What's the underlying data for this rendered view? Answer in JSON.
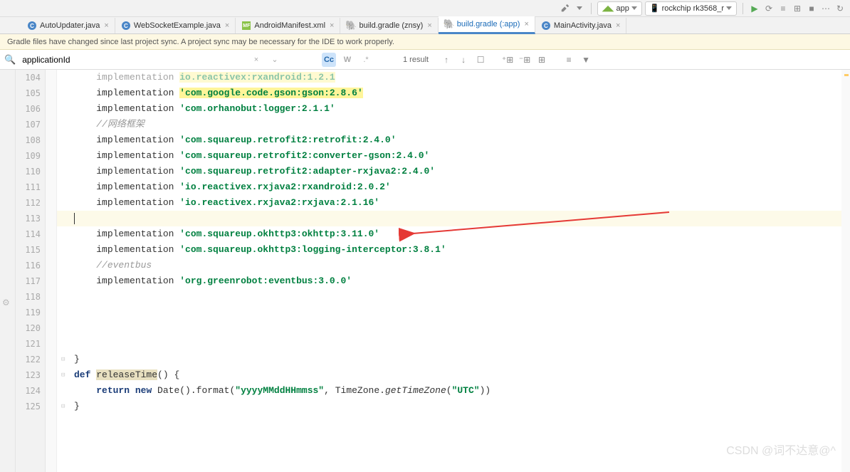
{
  "toolbar": {
    "run_config": "app",
    "device": "rockchip rk3568_r"
  },
  "tabs": [
    {
      "label": "AutoUpdater.java",
      "icon": "java",
      "active": false
    },
    {
      "label": "WebSocketExample.java",
      "icon": "java",
      "active": false
    },
    {
      "label": "AndroidManifest.xml",
      "icon": "manifest",
      "active": false
    },
    {
      "label": "build.gradle (znsy)",
      "icon": "gradle",
      "active": false
    },
    {
      "label": "build.gradle (:app)",
      "icon": "gradle",
      "active": true
    },
    {
      "label": "MainActivity.java",
      "icon": "java",
      "active": false
    }
  ],
  "notify": "Gradle files have changed since last project sync. A project sync may be necessary for the IDE to work properly.",
  "find": {
    "query": "applicationId",
    "result_count": "1 result"
  },
  "lines": {
    "start": 104,
    "end": 125
  },
  "code": {
    "l104": {
      "impl": "implementation",
      "dep": "io.reactivex:rxandroid:1.2.1"
    },
    "l105": {
      "impl": "implementation",
      "dep": "'com.google.code.gson:gson:2.8.6'"
    },
    "l106": {
      "impl": "implementation",
      "dep": "'com.orhanobut:logger:2.1.1'"
    },
    "l107": {
      "comment": "//网络框架"
    },
    "l108": {
      "impl": "implementation",
      "dep": "'com.squareup.retrofit2:retrofit:2.4.0'"
    },
    "l109": {
      "impl": "implementation",
      "dep": "'com.squareup.retrofit2:converter-gson:2.4.0'"
    },
    "l110": {
      "impl": "implementation",
      "dep": "'com.squareup.retrofit2:adapter-rxjava2:2.4.0'"
    },
    "l111": {
      "impl": "implementation",
      "dep": "'io.reactivex.rxjava2:rxandroid:2.0.2'"
    },
    "l112": {
      "impl": "implementation",
      "dep": "'io.reactivex.rxjava2:rxjava:2.1.16'"
    },
    "l114": {
      "impl": "implementation",
      "dep": "'com.squareup.okhttp3:okhttp:3.11.0'"
    },
    "l115": {
      "impl": "implementation",
      "dep": "'com.squareup.okhttp3:logging-interceptor:3.8.1'"
    },
    "l116": {
      "comment": "//eventbus"
    },
    "l117": {
      "impl": "implementation",
      "dep": "'org.greenrobot:eventbus:3.0.0'"
    },
    "l122": {
      "brace": "}"
    },
    "l123": {
      "def": "def",
      "name": "releaseTime",
      "rest": "() {"
    },
    "l124": {
      "ret": "return",
      "new": "new",
      "code1": " Date().format(",
      "str1": "\"yyyyMMddHHmmss\"",
      "code2": ", TimeZone.",
      "fn": "getTimeZone",
      "code3": "(",
      "str2": "\"UTC\"",
      "code4": "))"
    },
    "l125": {
      "brace": "}"
    }
  },
  "watermark": "CSDN @词不达意@^"
}
